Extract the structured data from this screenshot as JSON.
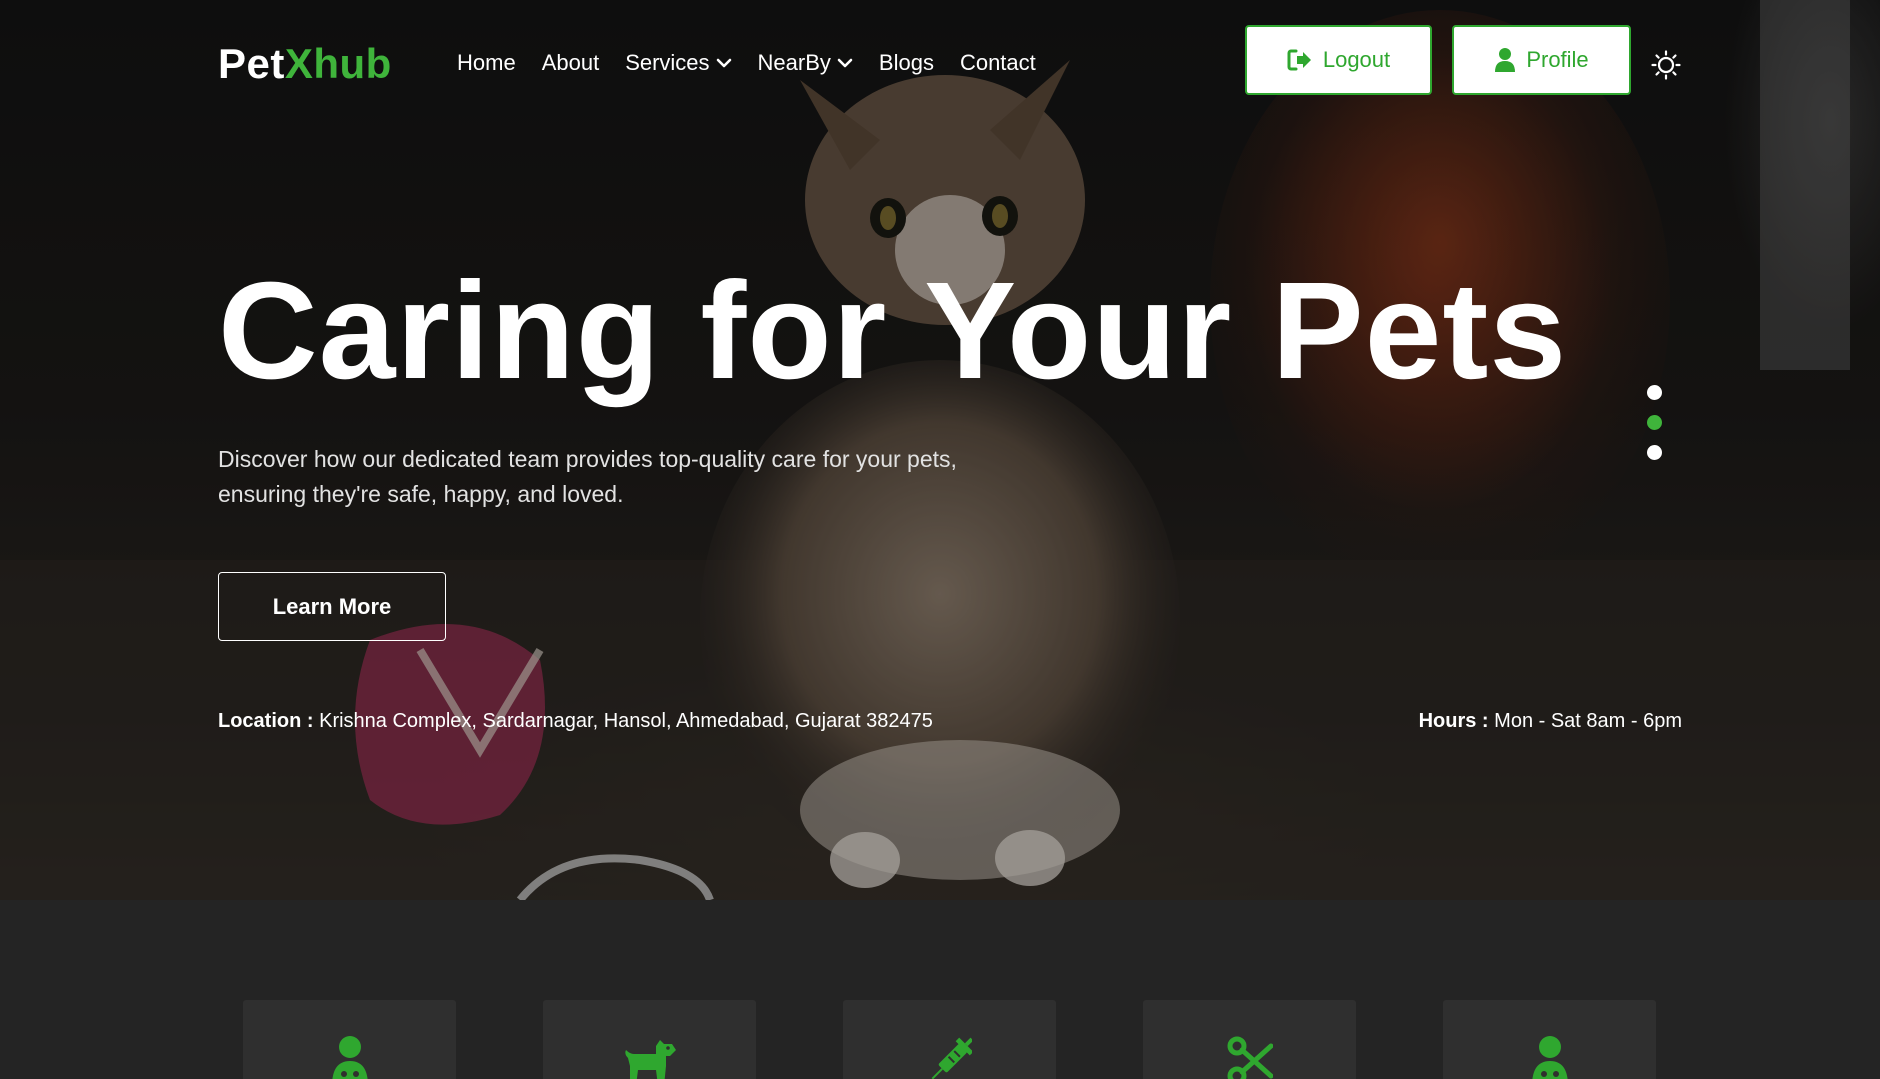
{
  "brand": {
    "name_part1": "Pet",
    "name_part2": "Xhub",
    "accent_color": "#3fb43b"
  },
  "nav": {
    "items": [
      {
        "label": "Home",
        "dropdown": false
      },
      {
        "label": "About",
        "dropdown": false
      },
      {
        "label": "Services",
        "dropdown": true
      },
      {
        "label": "NearBy",
        "dropdown": true
      },
      {
        "label": "Blogs",
        "dropdown": false
      },
      {
        "label": "Contact",
        "dropdown": false
      }
    ]
  },
  "header_buttons": {
    "logout_label": "Logout",
    "profile_label": "Profile",
    "logout_icon": "sign-out-icon",
    "profile_icon": "user-icon",
    "theme_icon": "sun-icon"
  },
  "hero": {
    "title": "Caring for Your Pets",
    "description": "Discover how our dedicated team provides top-quality care for your pets, ensuring they're safe, happy, and loved.",
    "cta_label": "Learn More",
    "location_label": "Location :",
    "location_value": "Krishna Complex, Sardarnagar, Hansol, Ahmedabad, Gujarat 382475",
    "hours_label": "Hours :",
    "hours_value": "Mon - Sat 8am - 6pm",
    "slides": {
      "count": 3,
      "active_index": 1
    }
  },
  "services": {
    "icons": [
      "user-doctor-icon",
      "dog-icon",
      "syringe-icon",
      "scissors-icon",
      "user-doctor-icon"
    ]
  }
}
